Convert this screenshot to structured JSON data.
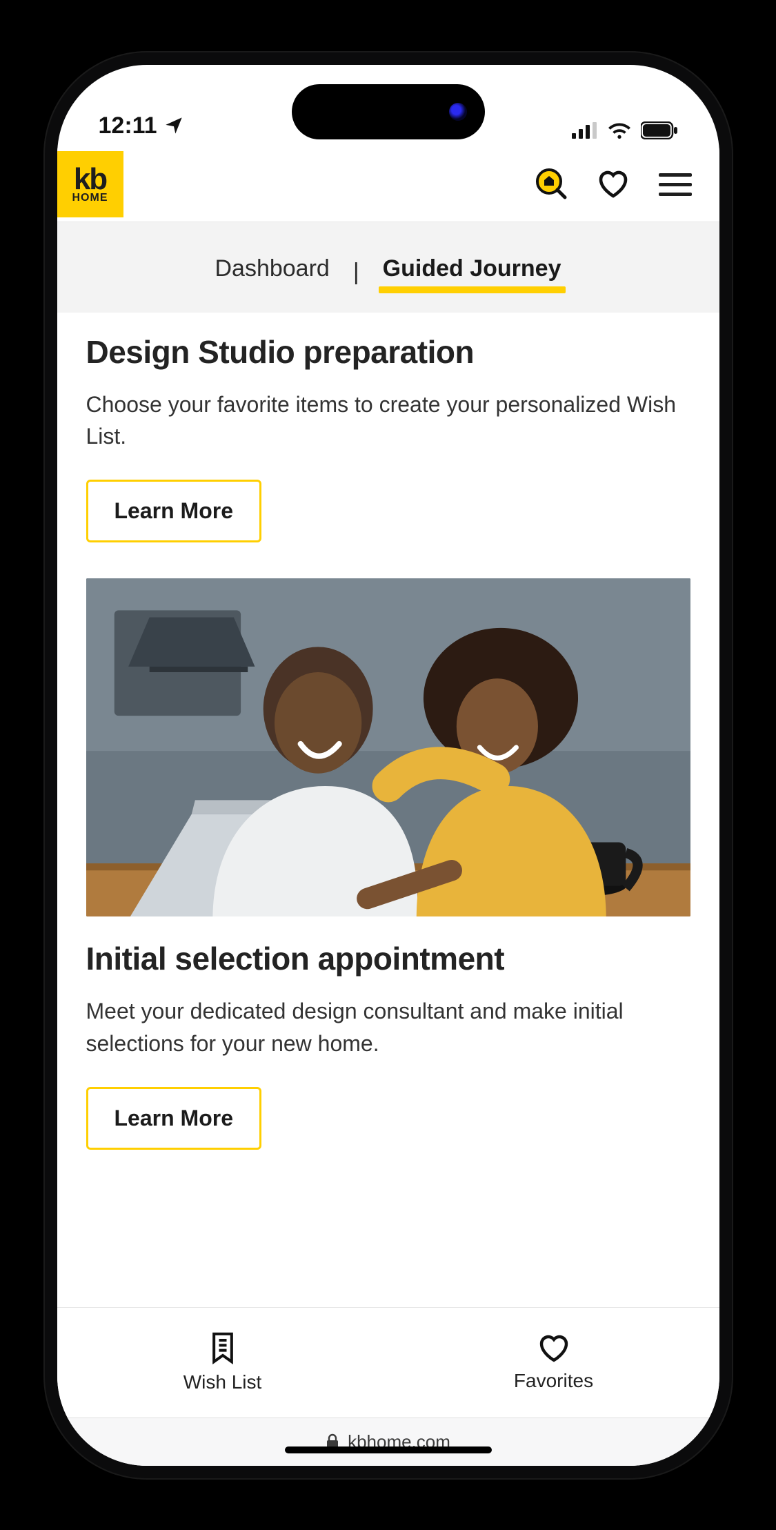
{
  "status": {
    "time": "12:11",
    "location_arrow": true
  },
  "brand": {
    "logo_top": "kb",
    "logo_bottom": "HOME",
    "accent": "#ffcf01"
  },
  "header_icons": {
    "search": "search-home-icon",
    "favorite": "heart-icon",
    "menu": "hamburger-icon"
  },
  "tabs": {
    "items": [
      {
        "label": "Dashboard",
        "active": false
      },
      {
        "label": "Guided Journey",
        "active": true
      }
    ],
    "separator": "|"
  },
  "sections": [
    {
      "title": "Design Studio preparation",
      "body": "Choose your favorite items to create your personalized Wish List.",
      "cta": "Learn More"
    },
    {
      "title": "Initial selection appointment",
      "body": "Meet your dedicated design consultant and make initial selections for your new home.",
      "cta": "Learn More"
    }
  ],
  "bottom_nav": [
    {
      "label": "Wish List",
      "icon": "bookmark-list-icon"
    },
    {
      "label": "Favorites",
      "icon": "heart-icon"
    }
  ],
  "browser": {
    "lock": "lock-icon",
    "domain": "kbhome.com"
  }
}
